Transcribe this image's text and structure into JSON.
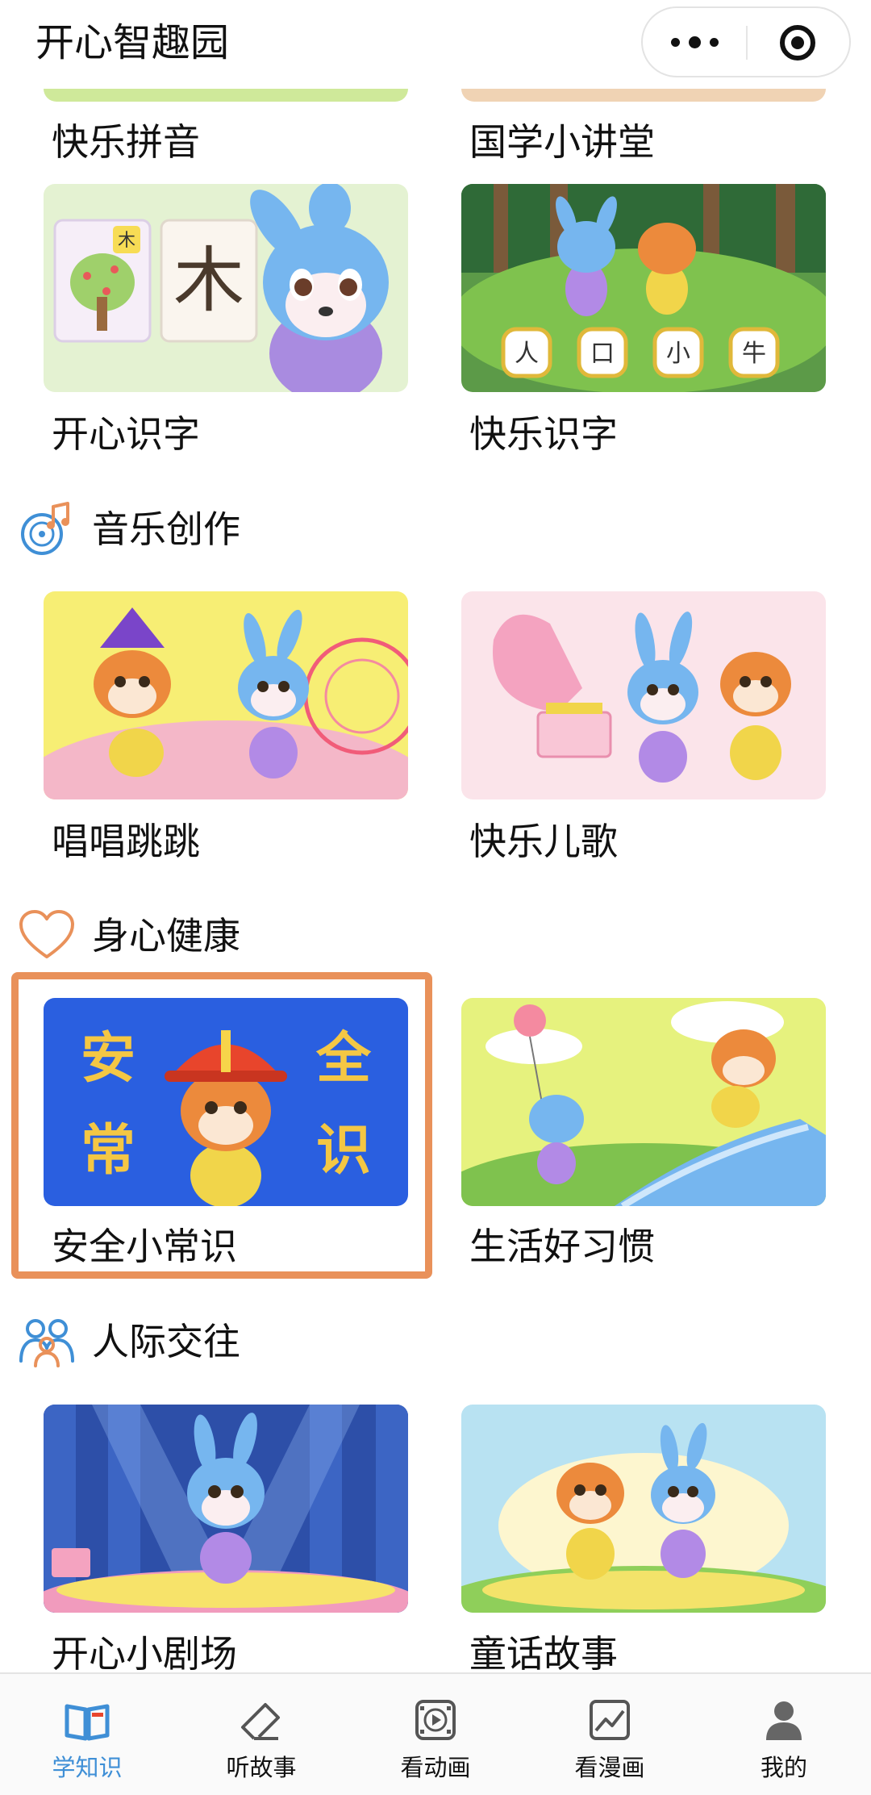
{
  "app": {
    "title": "开心智趣园"
  },
  "rows": [
    {
      "cards": [
        {
          "label": "快乐拼音"
        },
        {
          "label": "国学小讲堂"
        }
      ]
    },
    {
      "cards": [
        {
          "label": "开心识字",
          "thumb_text": "木",
          "badge": "木"
        },
        {
          "label": "快乐识字",
          "chars": [
            "人",
            "口",
            "小",
            "牛"
          ]
        }
      ]
    },
    {
      "cards": [
        {
          "label": "唱唱跳跳"
        },
        {
          "label": "快乐儿歌"
        }
      ]
    },
    {
      "cards": [
        {
          "label": "安全小常识",
          "chars": [
            "安",
            "全",
            "常",
            "识"
          ],
          "highlighted": true
        },
        {
          "label": "生活好习惯"
        }
      ]
    },
    {
      "cards": [
        {
          "label": "开心小剧场"
        },
        {
          "label": "童话故事"
        }
      ]
    }
  ],
  "sections": [
    {
      "title": "音乐创作",
      "icon": "music-disc-icon"
    },
    {
      "title": "身心健康",
      "icon": "heart-icon"
    },
    {
      "title": "人际交往",
      "icon": "people-icon"
    }
  ],
  "tabs": [
    {
      "label": "学知识",
      "icon": "book-icon",
      "active": true
    },
    {
      "label": "听故事",
      "icon": "eraser-icon",
      "active": false
    },
    {
      "label": "看动画",
      "icon": "film-icon",
      "active": false
    },
    {
      "label": "看漫画",
      "icon": "picture-icon",
      "active": false
    },
    {
      "label": "我的",
      "icon": "user-icon",
      "active": false
    }
  ],
  "colors": {
    "accent": "#3f8fd6",
    "highlight": "#e9915a",
    "icon_orange": "#e9915a",
    "icon_blue": "#3f8fd6"
  }
}
